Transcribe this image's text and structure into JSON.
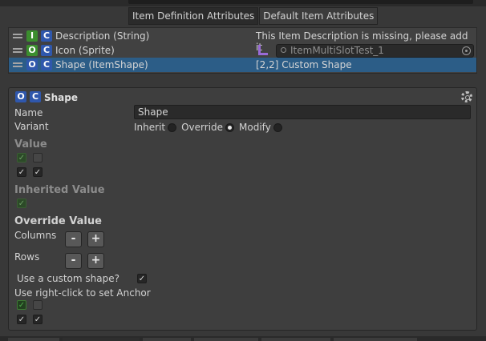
{
  "tabs": [
    {
      "label": "Item Definition Attributes",
      "active": true
    },
    {
      "label": "Default Item Attributes",
      "active": false
    }
  ],
  "attributes": [
    {
      "badges": [
        "I",
        "C"
      ],
      "label": "Description (String)",
      "value": "This Item Description is missing, please add it"
    },
    {
      "badges": [
        "O",
        "C"
      ],
      "label": "Icon (Sprite)",
      "value": "ItemMultiSlotTest_1"
    },
    {
      "badges": [
        "O",
        "C"
      ],
      "label": "Shape (ItemShape)",
      "value": "[2,2] Custom Shape",
      "selected": true
    }
  ],
  "panel": {
    "badges": [
      "O",
      "C"
    ],
    "title": "Shape",
    "name_label": "Name",
    "name_value": "Shape",
    "variant_label": "Variant",
    "variant_options": [
      "Inherit",
      "Override",
      "Modify"
    ],
    "variant_selected": "Override",
    "value_heading": "Value",
    "inherited_heading": "Inherited Value",
    "override_heading": "Override Value",
    "columns_label": "Columns",
    "rows_label": "Rows",
    "minus": "-",
    "plus": "+",
    "custom_shape_label": "Use a custom shape?",
    "custom_shape_checked": true,
    "anchor_label": "Use right-click to set Anchor"
  },
  "colors": {
    "background": "#383838",
    "selection": "#2c5d87",
    "badge_blue": "#2f57ac",
    "badge_green": "#3b8e2e",
    "link_purple": "#9a6bd8"
  }
}
